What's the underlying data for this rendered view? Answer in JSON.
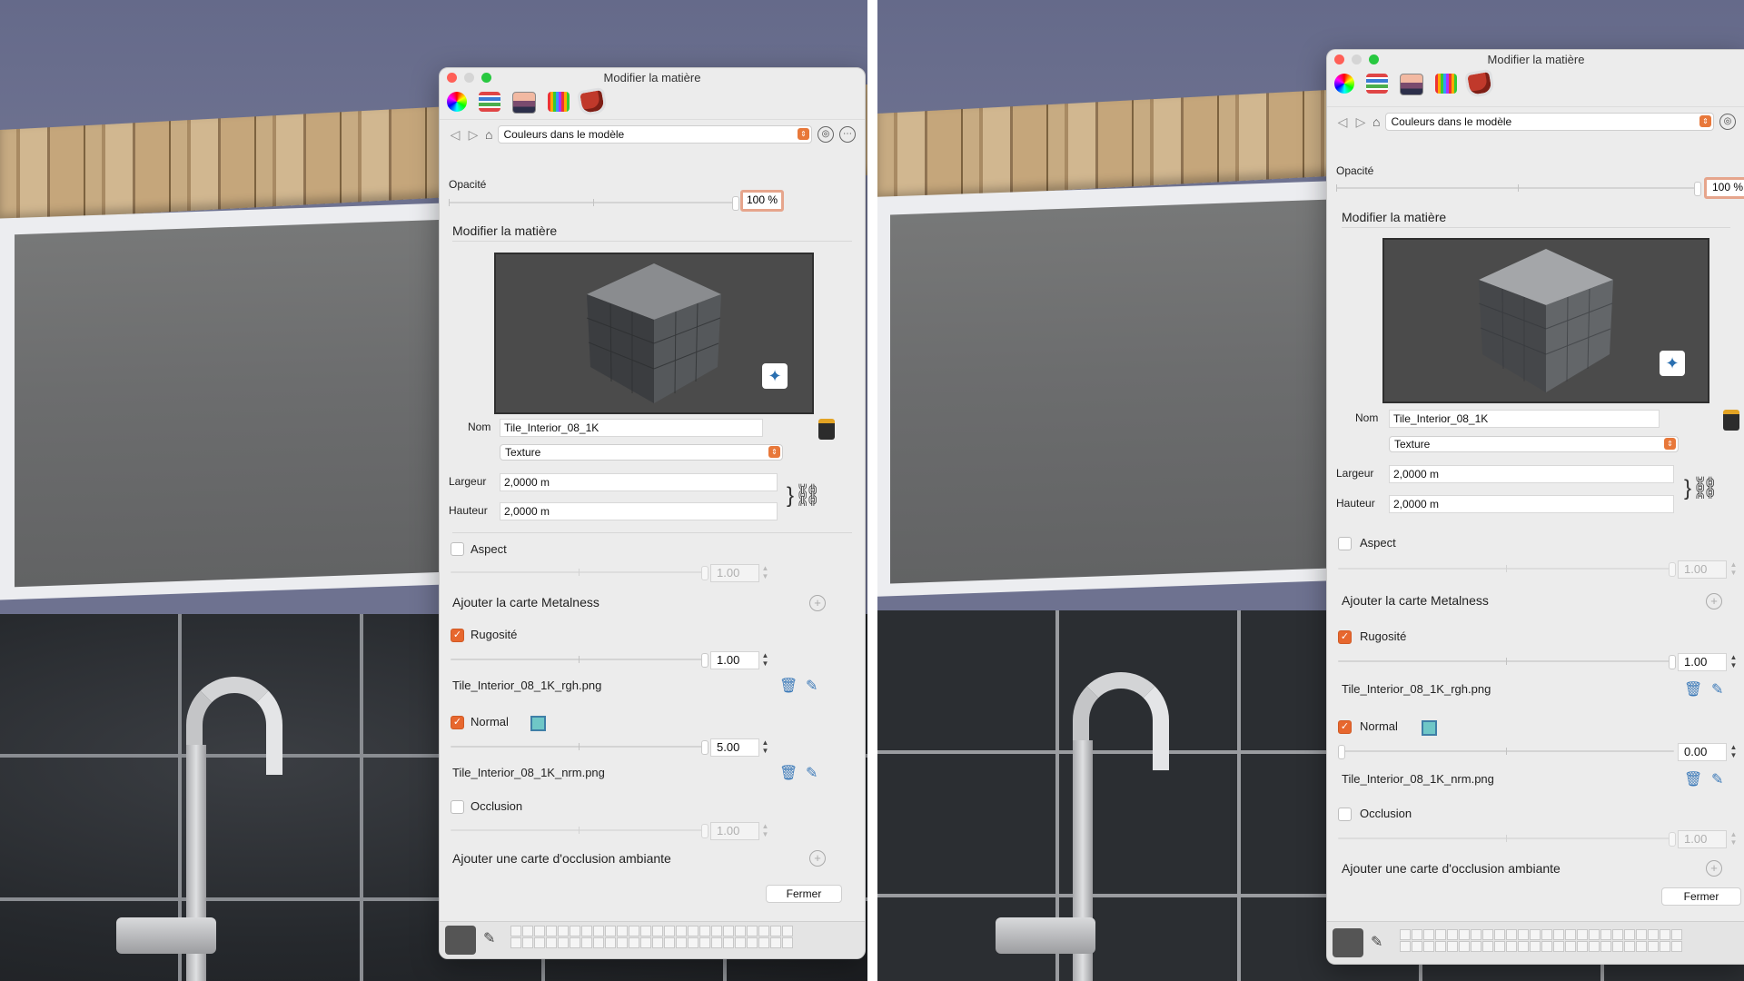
{
  "left": {
    "window": {
      "title": "Modifier la matière",
      "nav": {
        "collection": "Couleurs dans le modèle"
      },
      "opacity": {
        "label": "Opacité",
        "value": "100 %",
        "fraction": 1.0
      },
      "section_title": "Modifier la matière",
      "name_label": "Nom",
      "name_value": "Tile_Interior_08_1K",
      "type_value": "Texture",
      "width_label": "Largeur",
      "width_value": "2,0000 m",
      "height_label": "Hauteur",
      "height_value": "2,0000 m",
      "aspect": {
        "label": "Aspect",
        "checked": false,
        "value": "1.00"
      },
      "metalness_label": "Ajouter la carte Metalness",
      "roughness": {
        "label": "Rugosité",
        "checked": true,
        "value": "1.00",
        "file": "Tile_Interior_08_1K_rgh.png"
      },
      "normal": {
        "label": "Normal",
        "checked": true,
        "value": "5.00",
        "file": "Tile_Interior_08_1K_nrm.png"
      },
      "occlusion": {
        "label": "Occlusion",
        "checked": false,
        "value": "1.00"
      },
      "ambient_label": "Ajouter une carte d'occlusion ambiante",
      "close_label": "Fermer"
    }
  },
  "right": {
    "window": {
      "title": "Modifier la matière",
      "nav": {
        "collection": "Couleurs dans le modèle"
      },
      "opacity": {
        "label": "Opacité",
        "value": "100 %",
        "fraction": 1.0
      },
      "section_title": "Modifier la matière",
      "name_label": "Nom",
      "name_value": "Tile_Interior_08_1K",
      "type_value": "Texture",
      "width_label": "Largeur",
      "width_value": "2,0000 m",
      "height_label": "Hauteur",
      "height_value": "2,0000 m",
      "aspect": {
        "label": "Aspect",
        "checked": false,
        "value": "1.00"
      },
      "metalness_label": "Ajouter la carte Metalness",
      "roughness": {
        "label": "Rugosité",
        "checked": true,
        "value": "1.00",
        "file": "Tile_Interior_08_1K_rgh.png"
      },
      "normal": {
        "label": "Normal",
        "checked": true,
        "value": "0.00",
        "file": "Tile_Interior_08_1K_nrm.png"
      },
      "occlusion": {
        "label": "Occlusion",
        "checked": false,
        "value": "1.00"
      },
      "ambient_label": "Ajouter une carte d'occlusion ambiante",
      "close_label": "Fermer"
    }
  },
  "colors": {
    "accent": "#e7672e",
    "window_bg": "#ececec",
    "opacity_border": "#e6a58c"
  },
  "icons": [
    "color-wheel-icon",
    "color-sliders-icon",
    "image-color-icon",
    "crayons-icon",
    "paint-bucket-icon",
    "back-icon",
    "forward-icon",
    "home-icon",
    "dropdown-caret-icon",
    "material-sample-icon",
    "details-icon",
    "sparkle-icon",
    "material-picker-icon",
    "chain-link-icon",
    "trash-icon",
    "edit-icon",
    "add-icon",
    "eyedropper-icon",
    "checkbox-check-icon"
  ]
}
